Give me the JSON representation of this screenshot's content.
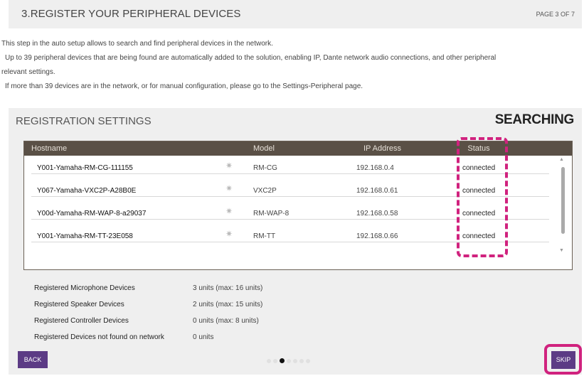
{
  "header": {
    "title": "3.REGISTER YOUR PERIPHERAL DEVICES",
    "page_indicator": "PAGE 3 OF 7"
  },
  "description": {
    "line1": "This step in the auto setup allows to search and find peripheral devices in the network.",
    "line2": "Up to 39 peripheral devices that are being found are automatically added to the solution, enabling IP, Dante network audio connections, and other peripheral",
    "line3": "relevant settings.",
    "line4": "If more than 39 devices are in the network, or for manual configuration, please go to the Settings-Peripheral page."
  },
  "registration": {
    "title": "REGISTRATION SETTINGS",
    "status": "SEARCHING"
  },
  "table": {
    "columns": [
      "Hostname",
      "Model",
      "IP Address",
      "Status"
    ],
    "rows": [
      {
        "hostname": "Y001-Yamaha-RM-CG-111155",
        "icon": "gear-icon",
        "model": "RM-CG",
        "ip": "192.168.0.4",
        "status": "connected"
      },
      {
        "hostname": "Y067-Yamaha-VXC2P-A28B0E",
        "icon": "gear-icon",
        "model": "VXC2P",
        "ip": "192.168.0.61",
        "status": "connected"
      },
      {
        "hostname": "Y00d-Yamaha-RM-WAP-8-a29037",
        "icon": "gear-icon",
        "model": "RM-WAP-8",
        "ip": "192.168.0.58",
        "status": "connected"
      },
      {
        "hostname": "Y001-Yamaha-RM-TT-23E058",
        "icon": "gear-icon",
        "model": "RM-TT",
        "ip": "192.168.0.66",
        "status": "connected"
      }
    ]
  },
  "summary": [
    {
      "label": "Registered Microphone Devices",
      "value": "3 units (max: 16 units)"
    },
    {
      "label": "Registered Speaker Devices",
      "value": "2 units (max: 15 units)"
    },
    {
      "label": "Registered Controller Devices",
      "value": "0 units (max: 8 units)"
    },
    {
      "label": "Registered Devices not found on network",
      "value": "0 units"
    }
  ],
  "footer": {
    "back_label": "BACK",
    "skip_label": "SKIP",
    "total_pages": 7,
    "current_page": 3
  },
  "colors": {
    "accent": "#5c3b85",
    "highlight": "#d0227e",
    "table_header": "#5a5046",
    "panel": "#efefef"
  }
}
